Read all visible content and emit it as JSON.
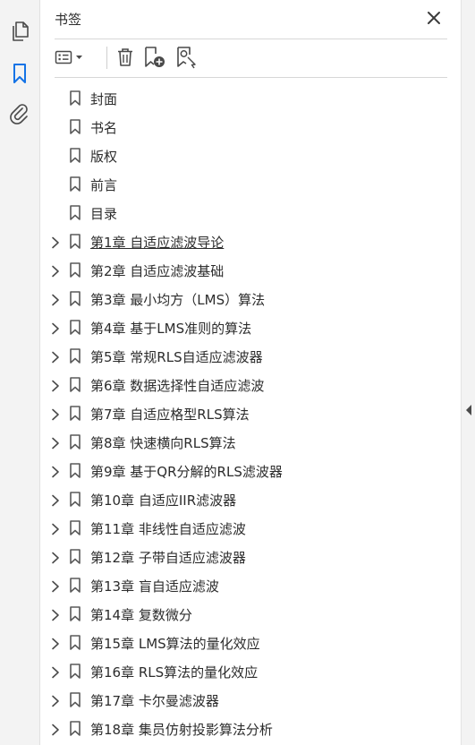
{
  "rail": {
    "icons": [
      "pages-icon",
      "bookmark-icon",
      "paperclip-icon"
    ],
    "active_color": "#1473e6"
  },
  "panel": {
    "title": "书签"
  },
  "bookmarks": [
    {
      "label": "封面",
      "expandable": false
    },
    {
      "label": "书名",
      "expandable": false
    },
    {
      "label": "版权",
      "expandable": false
    },
    {
      "label": "前言",
      "expandable": false
    },
    {
      "label": "目录",
      "expandable": false
    },
    {
      "label": "第1章  自适应滤波导论",
      "expandable": true,
      "hovered": true
    },
    {
      "label": "第2章  自适应滤波基础",
      "expandable": true
    },
    {
      "label": "第3章  最小均方（LMS）算法",
      "expandable": true
    },
    {
      "label": "第4章  基于LMS准则的算法",
      "expandable": true
    },
    {
      "label": "第5章  常规RLS自适应滤波器",
      "expandable": true
    },
    {
      "label": "第6章  数据选择性自适应滤波",
      "expandable": true
    },
    {
      "label": "第7章  自适应格型RLS算法",
      "expandable": true
    },
    {
      "label": "第8章  快速横向RLS算法",
      "expandable": true
    },
    {
      "label": "第9章  基于QR分解的RLS滤波器",
      "expandable": true
    },
    {
      "label": "第10章  自适应IIR滤波器",
      "expandable": true
    },
    {
      "label": "第11章  非线性自适应滤波",
      "expandable": true
    },
    {
      "label": "第12章  子带自适应滤波器",
      "expandable": true
    },
    {
      "label": "第13章  盲自适应滤波",
      "expandable": true
    },
    {
      "label": "第14章  复数微分",
      "expandable": true
    },
    {
      "label": "第15章  LMS算法的量化效应",
      "expandable": true
    },
    {
      "label": "第16章  RLS算法的量化效应",
      "expandable": true
    },
    {
      "label": "第17章  卡尔曼滤波器",
      "expandable": true
    },
    {
      "label": "第18章  集员仿射投影算法分析",
      "expandable": true
    }
  ]
}
